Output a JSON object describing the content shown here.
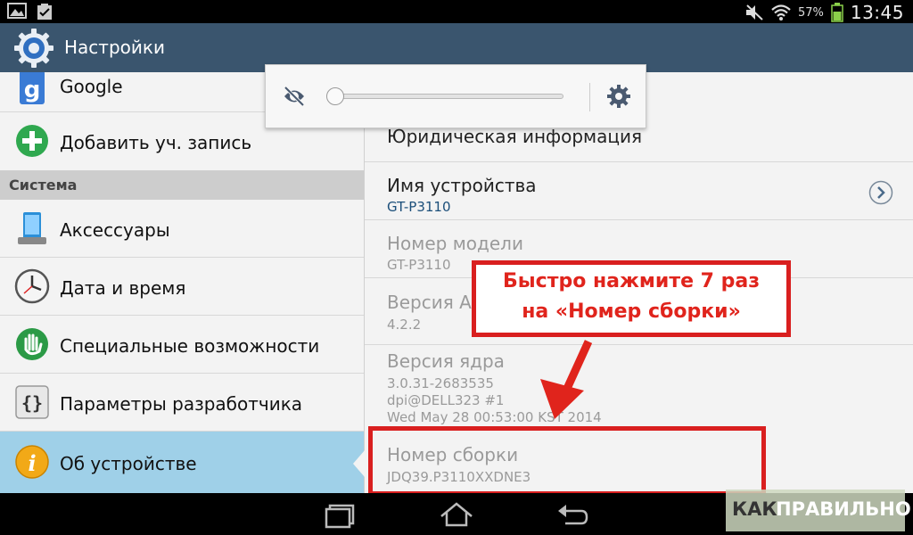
{
  "status_bar": {
    "battery_percent": "57%",
    "clock": "13:45",
    "icons": [
      "gallery-icon",
      "clipboard-check-icon",
      "mute-icon",
      "wifi-icon",
      "battery-icon"
    ]
  },
  "action_bar": {
    "title": "Настройки",
    "icon": "settings-gear-icon"
  },
  "sidebar": {
    "items_top": [
      {
        "label": "Google",
        "icon": "google-icon"
      },
      {
        "label": "Добавить уч. запись",
        "icon": "add-account-icon"
      }
    ],
    "section_header": "Система",
    "items_system": [
      {
        "label": "Аксессуары",
        "icon": "accessory-icon"
      },
      {
        "label": "Дата и время",
        "icon": "clock-icon"
      },
      {
        "label": "Специальные возможности",
        "icon": "accessibility-hand-icon"
      },
      {
        "label": "Параметры разработчика",
        "icon": "developer-braces-icon"
      },
      {
        "label": "Об устройстве",
        "icon": "info-icon",
        "selected": true
      }
    ]
  },
  "detail": {
    "rows": [
      {
        "title": "Юридическая информация",
        "subtitle": ""
      },
      {
        "title": "Имя устройства",
        "subtitle": "GT-P3110"
      },
      {
        "title": "Номер модели",
        "subtitle": "GT-P3110"
      },
      {
        "title": "Версия А",
        "subtitle": "4.2.2"
      },
      {
        "title": "Версия ядра",
        "subtitle_lines": [
          "3.0.31-2683535",
          "dpi@DELL323 #1",
          "Wed May 28 00:53:00 KST 2014"
        ]
      },
      {
        "title": "Номер сборки",
        "subtitle": "JDQ39.P3110XXDNE3"
      }
    ]
  },
  "brightness_popup": {
    "level": 0.0,
    "auto_icon": "auto-brightness-icon",
    "settings_icon": "gear-icon"
  },
  "annotation": {
    "line1": "Быстро нажмите 7 раз",
    "line2": "на «Номер сборки»",
    "color": "#d91f1f"
  },
  "nav_bar": {
    "buttons": [
      "recent-apps-icon",
      "home-icon",
      "back-icon"
    ]
  },
  "watermark": {
    "part1": "КАК",
    "part2": "ПРАВИЛЬНО"
  }
}
